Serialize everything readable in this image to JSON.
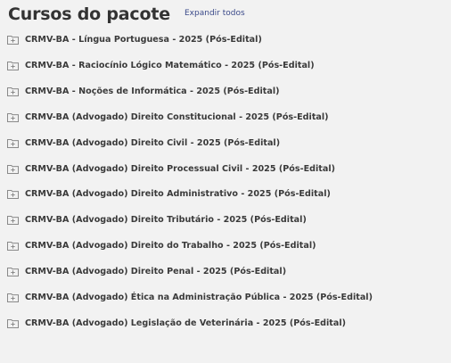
{
  "header": {
    "title": "Cursos do pacote",
    "expand_label": "Expandir todos"
  },
  "courses": [
    {
      "label": "CRMV-BA - Língua Portuguesa - 2025 (Pós-Edital)",
      "icon": "folder-plus-icon"
    },
    {
      "label": "CRMV-BA - Raciocínio Lógico Matemático - 2025 (Pós-Edital)",
      "icon": "folder-plus-icon"
    },
    {
      "label": "CRMV-BA - Noções de Informática - 2025 (Pós-Edital)",
      "icon": "folder-plus-icon"
    },
    {
      "label": "CRMV-BA (Advogado) Direito Constitucional - 2025 (Pós-Edital)",
      "icon": "folder-plus-icon"
    },
    {
      "label": "CRMV-BA (Advogado) Direito Civil - 2025 (Pós-Edital)",
      "icon": "folder-plus-icon"
    },
    {
      "label": "CRMV-BA (Advogado) Direito Processual Civil - 2025 (Pós-Edital)",
      "icon": "folder-plus-icon"
    },
    {
      "label": "CRMV-BA (Advogado) Direito Administrativo - 2025 (Pós-Edital)",
      "icon": "folder-plus-icon"
    },
    {
      "label": "CRMV-BA (Advogado) Direito Tributário - 2025 (Pós-Edital)",
      "icon": "folder-plus-icon"
    },
    {
      "label": "CRMV-BA (Advogado) Direito do Trabalho - 2025 (Pós-Edital)",
      "icon": "folder-plus-icon"
    },
    {
      "label": "CRMV-BA (Advogado) Direito Penal - 2025 (Pós-Edital)",
      "icon": "folder-plus-icon"
    },
    {
      "label": "CRMV-BA (Advogado) Ética na Administração Pública - 2025 (Pós-Edital)",
      "icon": "folder-plus-icon"
    },
    {
      "label": "CRMV-BA (Advogado) Legislação de Veterinária - 2025 (Pós-Edital)",
      "icon": "folder-plus-icon"
    }
  ],
  "colors": {
    "background": "#f2f2f2",
    "text": "#333333",
    "link": "#3b4a8a",
    "icon": "#8a8a8a"
  }
}
